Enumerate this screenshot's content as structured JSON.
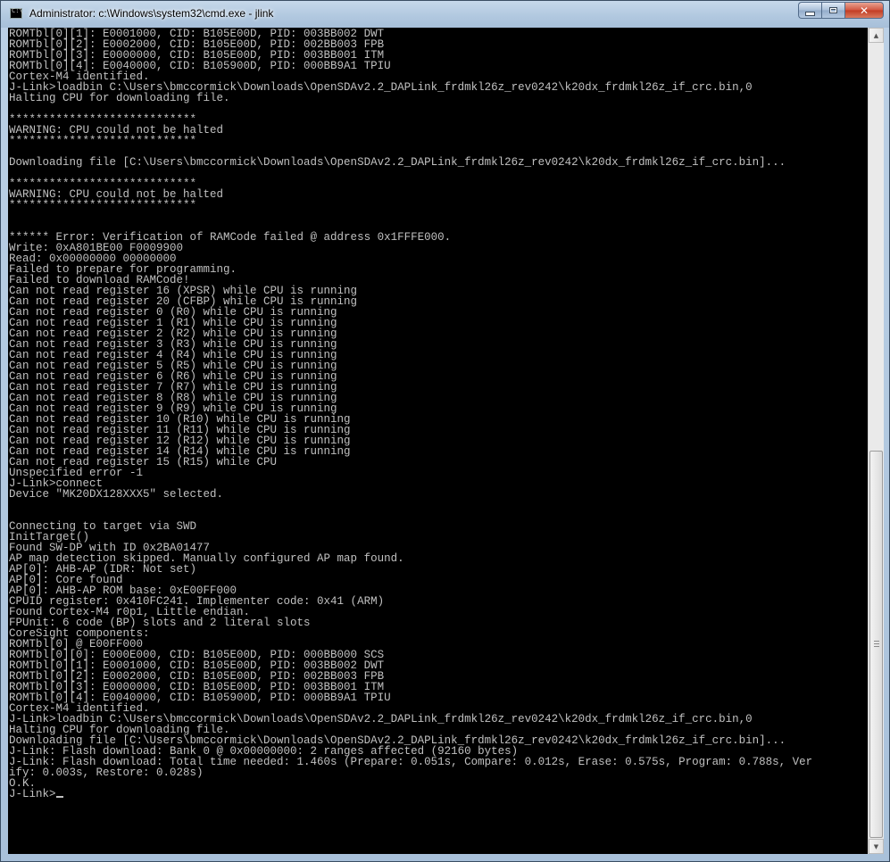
{
  "window": {
    "title": "Administrator: c:\\Windows\\system32\\cmd.exe - jlink",
    "app_icon": "cmd-icon",
    "buttons": {
      "minimize_icon": "minimize-icon",
      "maximize_icon": "maximize-icon",
      "close_icon": "close-icon",
      "close_glyph": "✕"
    }
  },
  "console": {
    "lines": [
      "ROMTbl[0][1]: E0001000, CID: B105E00D, PID: 003BB002 DWT",
      "ROMTbl[0][2]: E0002000, CID: B105E00D, PID: 002BB003 FPB",
      "ROMTbl[0][3]: E0000000, CID: B105E00D, PID: 003BB001 ITM",
      "ROMTbl[0][4]: E0040000, CID: B105900D, PID: 000BB9A1 TPIU",
      "Cortex-M4 identified.",
      "J-Link>loadbin C:\\Users\\bmccormick\\Downloads\\OpenSDAv2.2_DAPLink_frdmkl26z_rev0242\\k20dx_frdmkl26z_if_crc.bin,0",
      "Halting CPU for downloading file.",
      "",
      "****************************",
      "WARNING: CPU could not be halted",
      "****************************",
      "",
      "Downloading file [C:\\Users\\bmccormick\\Downloads\\OpenSDAv2.2_DAPLink_frdmkl26z_rev0242\\k20dx_frdmkl26z_if_crc.bin]...",
      "",
      "****************************",
      "WARNING: CPU could not be halted",
      "****************************",
      "",
      "",
      "****** Error: Verification of RAMCode failed @ address 0x1FFFE000.",
      "Write: 0xA801BE00 F0009900",
      "Read: 0x00000000 00000000",
      "Failed to prepare for programming.",
      "Failed to download RAMCode!",
      "Can not read register 16 (XPSR) while CPU is running",
      "Can not read register 20 (CFBP) while CPU is running",
      "Can not read register 0 (R0) while CPU is running",
      "Can not read register 1 (R1) while CPU is running",
      "Can not read register 2 (R2) while CPU is running",
      "Can not read register 3 (R3) while CPU is running",
      "Can not read register 4 (R4) while CPU is running",
      "Can not read register 5 (R5) while CPU is running",
      "Can not read register 6 (R6) while CPU is running",
      "Can not read register 7 (R7) while CPU is running",
      "Can not read register 8 (R8) while CPU is running",
      "Can not read register 9 (R9) while CPU is running",
      "Can not read register 10 (R10) while CPU is running",
      "Can not read register 11 (R11) while CPU is running",
      "Can not read register 12 (R12) while CPU is running",
      "Can not read register 14 (R14) while CPU is running",
      "Can not read register 15 (R15) while CPU",
      "Unspecified error -1",
      "J-Link>connect",
      "Device \"MK20DX128XXX5\" selected.",
      "",
      "",
      "Connecting to target via SWD",
      "InitTarget()",
      "Found SW-DP with ID 0x2BA01477",
      "AP map detection skipped. Manually configured AP map found.",
      "AP[0]: AHB-AP (IDR: Not set)",
      "AP[0]: Core found",
      "AP[0]: AHB-AP ROM base: 0xE00FF000",
      "CPUID register: 0x410FC241. Implementer code: 0x41 (ARM)",
      "Found Cortex-M4 r0p1, Little endian.",
      "FPUnit: 6 code (BP) slots and 2 literal slots",
      "CoreSight components:",
      "ROMTbl[0] @ E00FF000",
      "ROMTbl[0][0]: E000E000, CID: B105E00D, PID: 000BB000 SCS",
      "ROMTbl[0][1]: E0001000, CID: B105E00D, PID: 003BB002 DWT",
      "ROMTbl[0][2]: E0002000, CID: B105E00D, PID: 002BB003 FPB",
      "ROMTbl[0][3]: E0000000, CID: B105E00D, PID: 003BB001 ITM",
      "ROMTbl[0][4]: E0040000, CID: B105900D, PID: 000BB9A1 TPIU",
      "Cortex-M4 identified.",
      "J-Link>loadbin C:\\Users\\bmccormick\\Downloads\\OpenSDAv2.2_DAPLink_frdmkl26z_rev0242\\k20dx_frdmkl26z_if_crc.bin,0",
      "Halting CPU for downloading file.",
      "Downloading file [C:\\Users\\bmccormick\\Downloads\\OpenSDAv2.2_DAPLink_frdmkl26z_rev0242\\k20dx_frdmkl26z_if_crc.bin]...",
      "J-Link: Flash download: Bank 0 @ 0x00000000: 2 ranges affected (92160 bytes)",
      "J-Link: Flash download: Total time needed: 1.460s (Prepare: 0.051s, Compare: 0.012s, Erase: 0.575s, Program: 0.788s, Ver",
      "ify: 0.003s, Restore: 0.028s)",
      "O.K.",
      "J-Link>"
    ]
  },
  "scrollbar": {
    "up_icon": "scroll-up-icon",
    "down_icon": "scroll-down-icon",
    "up_glyph": "▲",
    "down_glyph": "▼"
  }
}
